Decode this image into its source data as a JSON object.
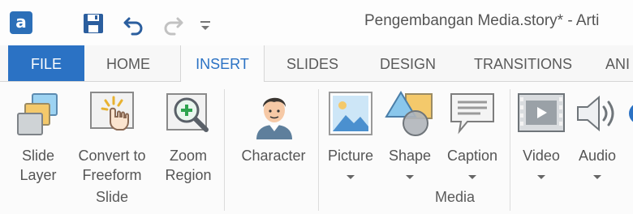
{
  "window": {
    "title": "Pengembangan Media.story* - Arti"
  },
  "app_icon": {
    "letter": "a"
  },
  "quick_access": [
    {
      "name": "save-icon"
    },
    {
      "name": "undo-icon"
    },
    {
      "name": "redo-icon"
    },
    {
      "name": "customize-qat-icon"
    }
  ],
  "tabs": {
    "file": "FILE",
    "home": "HOME",
    "insert": "INSERT",
    "slides": "SLIDES",
    "design": "DESIGN",
    "transitions": "TRANSITIONS",
    "animations": "ANI"
  },
  "ribbon": {
    "slide_group": {
      "label": "Slide",
      "slide_layer": {
        "line1": "Slide",
        "line2": "Layer"
      },
      "convert_freeform": {
        "line1": "Convert to",
        "line2": "Freeform"
      },
      "zoom_region": {
        "line1": "Zoom",
        "line2": "Region"
      }
    },
    "media_group": {
      "label": "Media",
      "character": "Character",
      "picture": "Picture",
      "shape": "Shape",
      "caption": "Caption",
      "video": "Video",
      "audio": "Audio"
    }
  },
  "colors": {
    "accent": "#2b72c4",
    "file_tab": "#2b72c4",
    "ribbon_bg": "#fbfbfb"
  }
}
